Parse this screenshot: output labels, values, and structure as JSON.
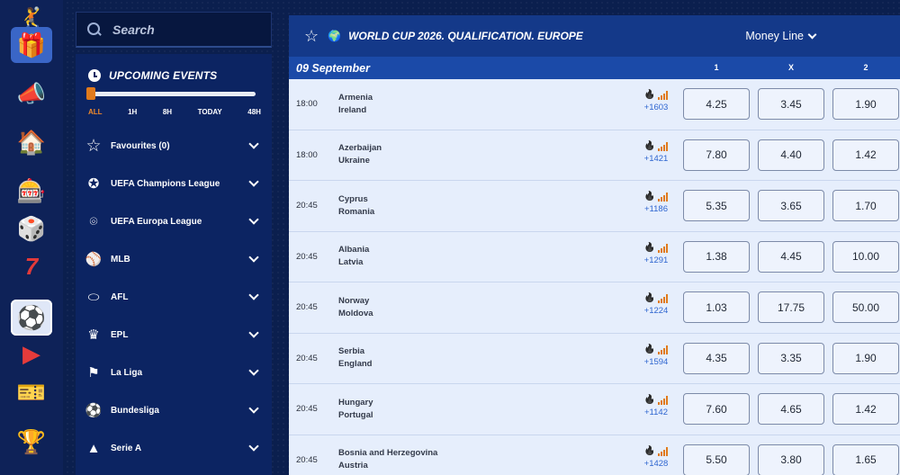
{
  "rail": [
    {
      "icon": "avatar-icon",
      "glyph": "🤾"
    },
    {
      "icon": "gift-box-icon",
      "glyph": "🎁"
    },
    {
      "icon": "megaphone-icon",
      "glyph": "📣"
    },
    {
      "icon": "home-icon",
      "glyph": "🏠"
    },
    {
      "icon": "poker-chip-icon",
      "glyph": "🎰"
    },
    {
      "icon": "dice-icon",
      "glyph": "🎲"
    },
    {
      "icon": "slots-777-icon",
      "glyph": "7"
    },
    {
      "icon": "soccer-ball-icon",
      "glyph": "⚽"
    },
    {
      "icon": "live-play-icon",
      "glyph": "▶"
    },
    {
      "icon": "ticket-icon",
      "glyph": "🎫"
    },
    {
      "icon": "trophy-icon",
      "glyph": "🏆"
    }
  ],
  "search": {
    "placeholder": "Search"
  },
  "upcoming": {
    "title": "UPCOMING EVENTS",
    "filters": [
      "ALL",
      "1H",
      "8H",
      "TODAY",
      "48H"
    ],
    "selected_filter": "ALL"
  },
  "sports": [
    {
      "label": "Favourites (0)",
      "icon": "star-outline-icon",
      "glyph": "☆"
    },
    {
      "label": "UEFA Champions League",
      "icon": "champions-league-icon",
      "glyph": "✪"
    },
    {
      "label": "UEFA Europa League",
      "icon": "europa-league-icon",
      "glyph": "⌾"
    },
    {
      "label": "MLB",
      "icon": "mlb-icon",
      "glyph": "⚾"
    },
    {
      "label": "AFL",
      "icon": "afl-icon",
      "glyph": "⬭"
    },
    {
      "label": "EPL",
      "icon": "epl-lion-icon",
      "glyph": "♛"
    },
    {
      "label": "La Liga",
      "icon": "laliga-icon",
      "glyph": "⚑"
    },
    {
      "label": "Bundesliga",
      "icon": "bundesliga-icon",
      "glyph": "⚽"
    },
    {
      "label": "Serie A",
      "icon": "serie-a-icon",
      "glyph": "▲"
    }
  ],
  "header": {
    "league": "WORLD CUP 2026. QUALIFICATION. EUROPE",
    "market": "Money Line"
  },
  "date_bar": {
    "date": "09 September",
    "columns": [
      "1",
      "X",
      "2"
    ]
  },
  "matches": [
    {
      "time": "18:00",
      "home": "Armenia",
      "away": "Ireland",
      "count": "+1603",
      "odds": [
        "4.25",
        "3.45",
        "1.90"
      ]
    },
    {
      "time": "18:00",
      "home": "Azerbaijan",
      "away": "Ukraine",
      "count": "+1421",
      "odds": [
        "7.80",
        "4.40",
        "1.42"
      ]
    },
    {
      "time": "20:45",
      "home": "Cyprus",
      "away": "Romania",
      "count": "+1186",
      "odds": [
        "5.35",
        "3.65",
        "1.70"
      ]
    },
    {
      "time": "20:45",
      "home": "Albania",
      "away": "Latvia",
      "count": "+1291",
      "odds": [
        "1.38",
        "4.45",
        "10.00"
      ]
    },
    {
      "time": "20:45",
      "home": "Norway",
      "away": "Moldova",
      "count": "+1224",
      "odds": [
        "1.03",
        "17.75",
        "50.00"
      ]
    },
    {
      "time": "20:45",
      "home": "Serbia",
      "away": "England",
      "count": "+1594",
      "odds": [
        "4.35",
        "3.35",
        "1.90"
      ]
    },
    {
      "time": "20:45",
      "home": "Hungary",
      "away": "Portugal",
      "count": "+1142",
      "odds": [
        "7.60",
        "4.65",
        "1.42"
      ]
    },
    {
      "time": "20:45",
      "home": "Bosnia and Herzegovina",
      "away": "Austria",
      "count": "+1428",
      "odds": [
        "5.50",
        "3.80",
        "1.65"
      ]
    }
  ]
}
